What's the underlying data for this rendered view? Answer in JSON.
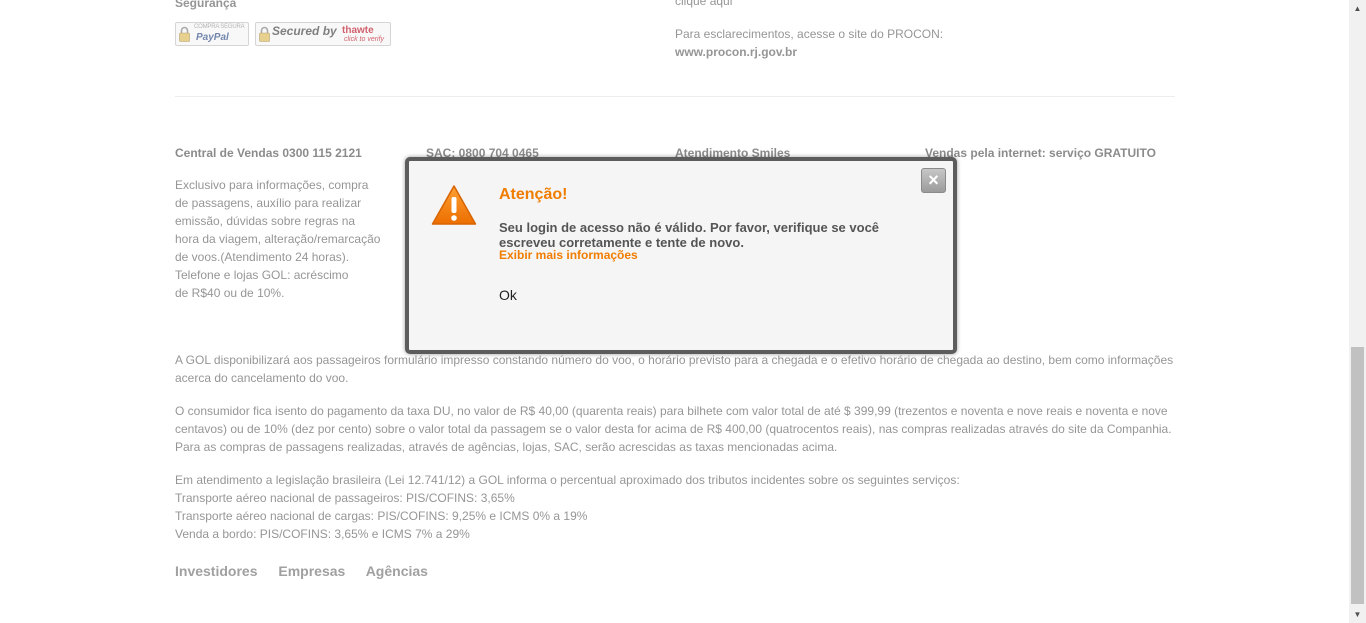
{
  "security": {
    "heading": "Segurança",
    "paypal_badge": {
      "top": "COMPRA SEGURA",
      "main": "PayPal"
    },
    "thawte_badge": {
      "main": "Secured by",
      "brand": "thawte",
      "sub": "click to verify"
    }
  },
  "procon": {
    "top_link": "clique aqui",
    "text": "Para esclarecimentos, acesse o site do PROCON:",
    "url": "www.procon.rj.gov.br"
  },
  "contacts": {
    "central": "Central de Vendas 0300 115 2121",
    "sac": "SAC: 0800 704 0465",
    "smiles": "Atendimento Smiles",
    "internet": "Vendas pela internet: serviço GRATUITO",
    "central_lines": [
      "Exclusivo para informações, compra",
      "de passagens, auxílio para realizar",
      "emissão, dúvidas sobre regras na",
      "hora da viagem, alteração/remarcação",
      "de voos.(Atendimento 24 horas).",
      "Telefone e lojas GOL: acréscimo",
      "de R$40 ou de 10%."
    ]
  },
  "paragraphs": {
    "p1": [
      "A GOL disponibilizará aos passageiros formulário impresso constando número do voo, o horário previsto para a chegada e o efetivo horário de chegada ao destino, bem como informações",
      "acerca do cancelamento do voo."
    ],
    "p2": [
      "O consumidor fica isento do pagamento da taxa DU, no valor de R$ 40,00 (quarenta reais) para bilhete com valor total de até $ 399,99 (trezentos e noventa e nove reais e noventa e nove",
      "centavos) ou de 10% (dez por cento) sobre o valor total da passagem se o valor desta for acima de R$ 400,00 (quatrocentos reais), nas compras realizadas através do site da Companhia.",
      "Para as compras de passagens realizadas, através de agências, lojas, SAC, serão acrescidas as taxas mencionadas acima."
    ],
    "p3": [
      "Em atendimento a legislação brasileira (Lei 12.741/12) a GOL informa o percentual aproximado dos tributos incidentes sobre os seguintes serviços:",
      "Transporte aéreo nacional de passageiros: PIS/COFINS: 3,65%",
      "Transporte aéreo nacional de cargas: PIS/COFINS: 9,25% e ICMS 0% a 19%",
      "Venda a bordo: PIS/COFINS: 3,65% e ICMS 7% a 29%"
    ]
  },
  "footer_links": [
    "Investidores",
    "Empresas",
    "Agências"
  ],
  "modal": {
    "title": "Atenção!",
    "message": "Seu login de acesso não é válido. Por favor, verifique se você escreveu corretamente e tente de novo.",
    "more_link": "Exibir mais informações",
    "ok": "Ok",
    "close": "×",
    "accent_color": "#f07d00"
  },
  "icons": {
    "warning": "warning-triangle-icon",
    "close": "close-icon",
    "lock": "padlock-icon"
  }
}
